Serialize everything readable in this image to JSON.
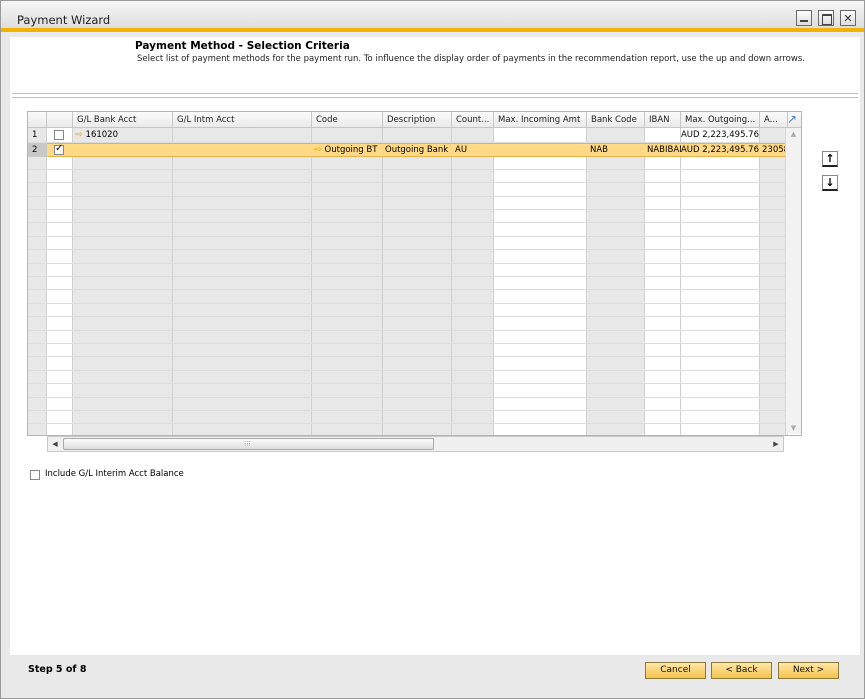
{
  "window": {
    "title": "Payment Wizard"
  },
  "header": {
    "title": "Payment Method - Selection Criteria",
    "description": "Select list of payment methods for the payment run. To influence the display order of payments in the recommendation report, use the up and down arrows."
  },
  "table": {
    "columns": [
      "G/L Bank Acct",
      "G/L Intm Acct",
      "Code",
      "Description",
      "Count...",
      "Max. Incoming Amt",
      "Bank Code",
      "IBAN",
      "Max. Outgoing...",
      "A..."
    ],
    "rows": [
      {
        "num": "1",
        "checked": false,
        "gl_bank_acct": "161020",
        "gl_intm_acct": "",
        "code": "",
        "description": "",
        "country": "",
        "max_incoming": "",
        "bank_code": "",
        "iban": "",
        "max_outgoing": "AUD 2,223,495.76",
        "account": ""
      },
      {
        "num": "2",
        "checked": true,
        "gl_bank_acct": "",
        "gl_intm_acct": "",
        "code": "Outgoing BT",
        "description": "Outgoing Bank T",
        "country": "AU",
        "max_incoming": "",
        "bank_code": "NAB",
        "iban": "NABIBAN",
        "max_outgoing": "AUD 2,223,495.76",
        "account": "23058"
      }
    ]
  },
  "options": {
    "include_interim_label": "Include G/L Interim Acct Balance"
  },
  "footer": {
    "step": "Step 5 of 8",
    "cancel": "Cancel",
    "back": "< Back",
    "next": "Next >"
  },
  "colors": {
    "accent": "#f2b300",
    "selected_row": "#ffd985",
    "button": "#f6c24a"
  }
}
